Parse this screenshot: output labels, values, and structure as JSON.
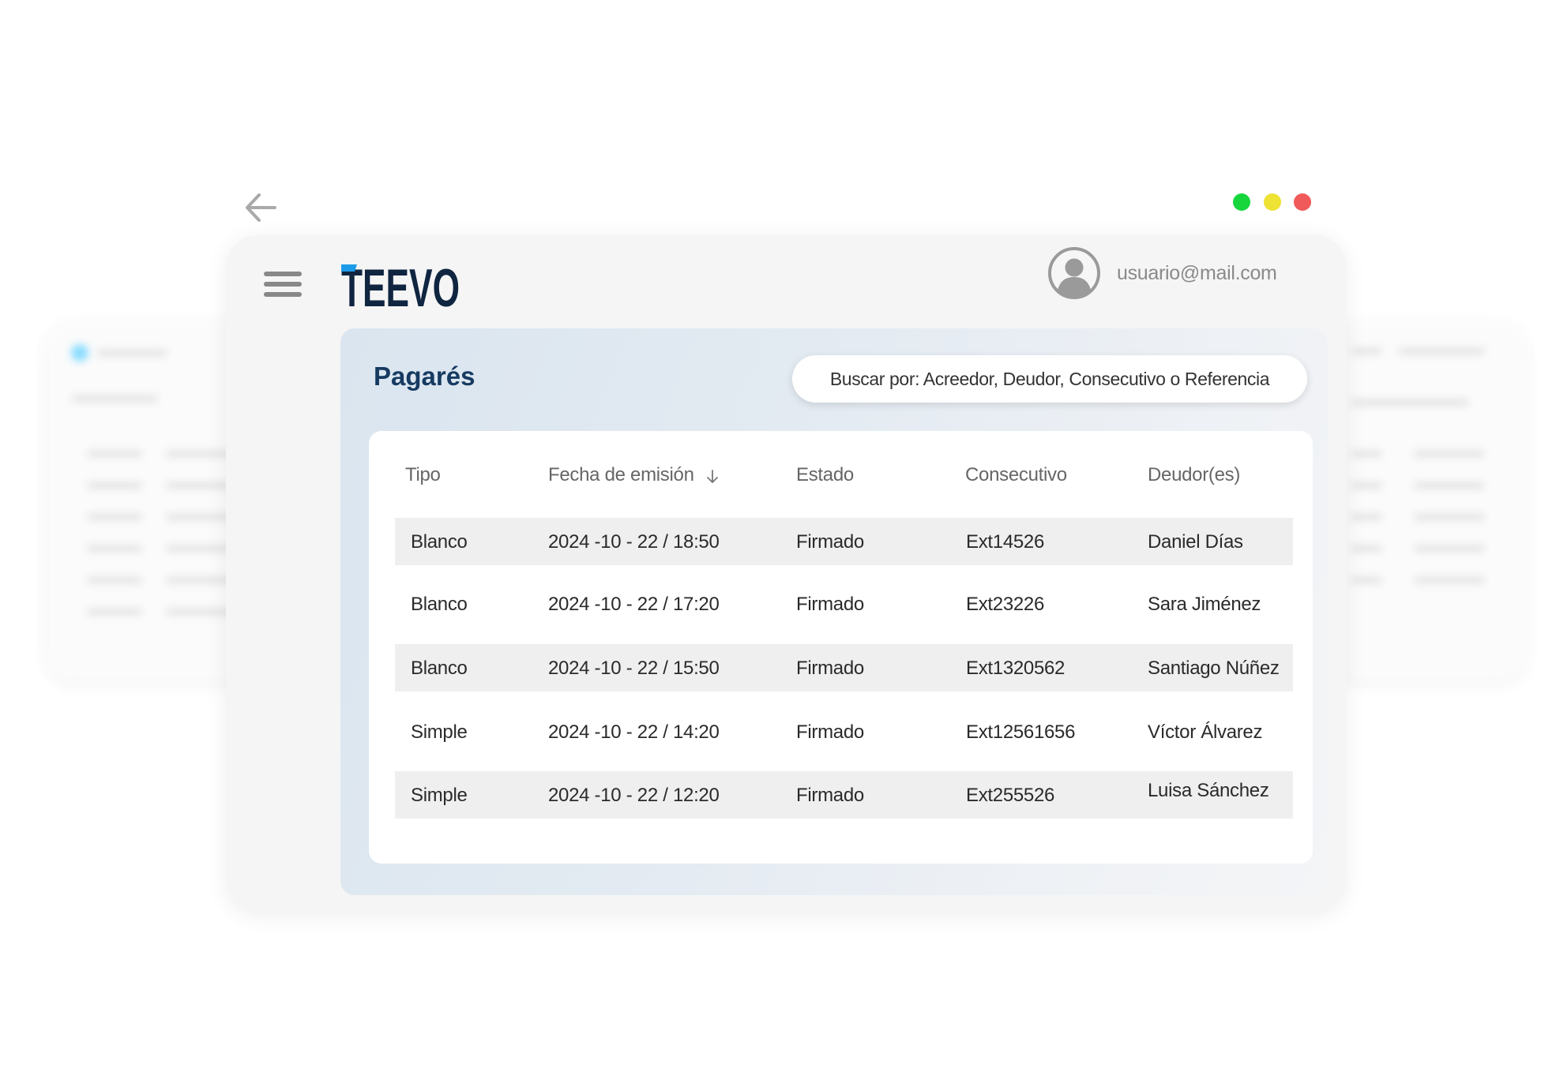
{
  "user": {
    "email": "usuario@mail.com"
  },
  "logo": {
    "text": "TEEVO",
    "accent_color": "#1e9be8",
    "text_color": "#0f2540"
  },
  "page": {
    "title": "Pagarés"
  },
  "search": {
    "placeholder": "Buscar por: Acreedor, Deudor, Consecutivo o Referencia"
  },
  "table": {
    "columns": [
      "Tipo",
      "Fecha de emisión",
      "Estado",
      "Consecutivo",
      "Deudor(es)"
    ],
    "sorted_column": "Fecha de emisión",
    "sort_direction": "descending",
    "rows": [
      {
        "tipo": "Blanco",
        "fecha": "2024 -10 - 22 / 18:50",
        "estado": "Firmado",
        "consecutivo": "Ext14526",
        "deudor": "Daniel Días"
      },
      {
        "tipo": "Blanco",
        "fecha": "2024 -10 - 22  / 17:20",
        "estado": "Firmado",
        "consecutivo": "Ext23226",
        "deudor": "Sara Jiménez"
      },
      {
        "tipo": "Blanco",
        "fecha": "2024 -10 - 22  / 15:50",
        "estado": "Firmado",
        "consecutivo": "Ext1320562",
        "deudor": "Santiago Núñez"
      },
      {
        "tipo": "Simple",
        "fecha": "2024 -10 - 22  / 14:20",
        "estado": "Firmado",
        "consecutivo": "Ext12561656",
        "deudor": "Víctor Álvarez"
      },
      {
        "tipo": "Simple",
        "fecha": "2024 -10 - 22  / 12:20",
        "estado": "Firmado",
        "consecutivo": "Ext255526",
        "deudor": "Luisa Sánchez"
      }
    ]
  },
  "window_controls": {
    "green": "#16d63c",
    "yellow": "#eee234",
    "red": "#f15a5a"
  },
  "icons": {
    "back": "arrow-left-icon",
    "menu": "hamburger-menu-icon",
    "avatar": "user-avatar-icon",
    "sort": "arrow-down-icon"
  }
}
